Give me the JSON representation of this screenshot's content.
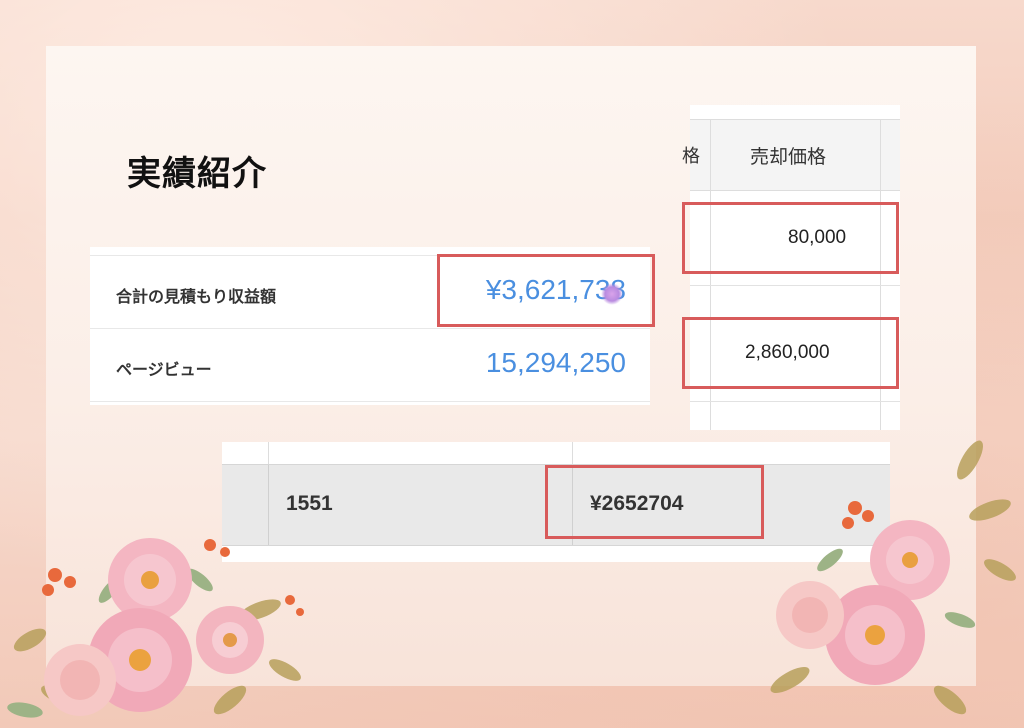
{
  "title": "実績紹介",
  "summary": {
    "rows": [
      {
        "label": "合計の見積もり収益額",
        "value": "¥3,621,738"
      },
      {
        "label": "ページビュー",
        "value": "15,294,250"
      }
    ]
  },
  "sales_table": {
    "header_cut": "格",
    "header": "売却価格",
    "values": [
      "80,000",
      "2,860,000"
    ]
  },
  "bottom_table": {
    "cells": [
      "1551",
      "¥2652704"
    ]
  },
  "colors": {
    "highlight": "#d85b5b",
    "value_blue": "#4a8fe0",
    "background": "#f7d9cc"
  }
}
